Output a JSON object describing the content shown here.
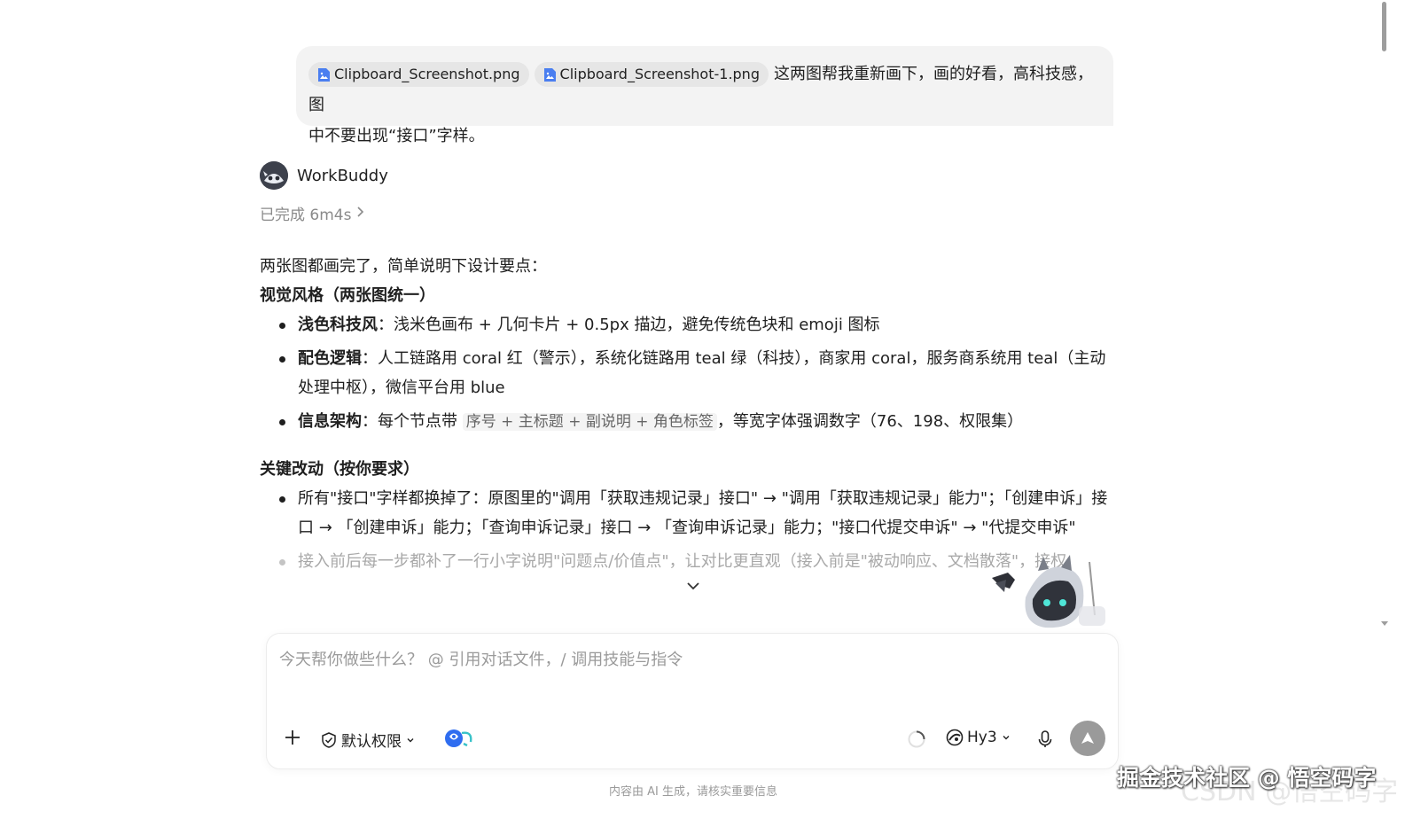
{
  "user_message": {
    "attachments": [
      {
        "name": "Clipboard_Screenshot.png",
        "icon": "image-file-icon"
      },
      {
        "name": "Clipboard_Screenshot-1.png",
        "icon": "image-file-icon"
      }
    ],
    "text_line1": "这两图帮我重新画下，画的好看，高科技感，图",
    "text_line2": "中不要出现“接口”字样。"
  },
  "assistant": {
    "name": "WorkBuddy",
    "status": "已完成 6m4s"
  },
  "answer": {
    "intro": "两张图都画完了，简单说明下设计要点：",
    "section1_title": "视觉风格（两张图统一）",
    "section1_items": [
      {
        "label": "浅色科技风",
        "text": "：浅米色画布 + 几何卡片 + 0.5px 描边，避免传统色块和 emoji 图标"
      },
      {
        "label": "配色逻辑",
        "text": "：人工链路用 coral 红（警示），系统化链路用 teal 绿（科技），商家用 coral，服务商系统用 teal（主动处理中枢），微信平台用 blue"
      },
      {
        "label": "信息架构",
        "text_before": "：每个节点带 ",
        "code": "序号 + 主标题 + 副说明 + 角色标签",
        "text_after": "，等宽字体强调数字（76、198、权限集）"
      }
    ],
    "section2_title": "关键改动（按你要求）",
    "section2_items": [
      {
        "text": "所有\"接口\"字样都换掉了：原图里的\"调用「获取违规记录」接口\" → \"调用「获取违规记录」能力\"；「创建申诉」接口 → 「创建申诉」能力；「查询申诉记录」接口 → 「查询申诉记录」能力；\"接口代提交申诉\" → \"代提交申诉\""
      },
      {
        "text": "接入前后每一步都补了一行小字说明\"问题点/价值点\"，让对比更直观（接入前是\"被动响应、文档散落\"，接权"
      }
    ]
  },
  "composer": {
    "placeholder": "今天帮你做些什么？ @ 引用对话文件，/ 调用技能与指令",
    "permission_label": "默认权限",
    "model_label": "Hy3"
  },
  "disclaimer": "内容由 AI 生成，请核实重要信息",
  "watermark": "掘金技术社区 @ 悟空码字",
  "watermark_faded": "CSDN @悟空码字",
  "colors": {
    "bubble_bg": "#f3f3f3",
    "file_icon": "#4a7ef0",
    "send_button": "#9a9a9a",
    "ai_icon_blue": "#2f6df0"
  }
}
